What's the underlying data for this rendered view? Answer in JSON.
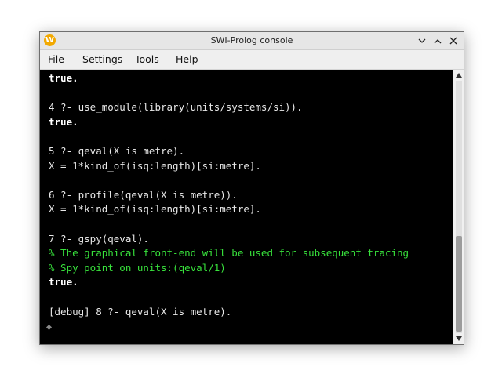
{
  "window": {
    "title": "SWI-Prolog console",
    "app_icon_letter": "W"
  },
  "menu": {
    "file": {
      "underline": "F",
      "rest": "ile"
    },
    "settings": {
      "underline": "S",
      "rest": "ettings"
    },
    "tools": {
      "underline": "T",
      "rest": "ools"
    },
    "help": {
      "underline": "H",
      "rest": "elp"
    }
  },
  "console": {
    "lines": [
      {
        "text": "true.",
        "style": "bold"
      },
      {
        "text": "",
        "style": "normal"
      },
      {
        "text": "4 ?- use_module(library(units/systems/si)).",
        "style": "normal"
      },
      {
        "text": "true.",
        "style": "bold"
      },
      {
        "text": "",
        "style": "normal"
      },
      {
        "text": "5 ?- qeval(X is metre).",
        "style": "normal"
      },
      {
        "text": "X = 1*kind_of(isq:length)[si:metre].",
        "style": "normal"
      },
      {
        "text": "",
        "style": "normal"
      },
      {
        "text": "6 ?- profile(qeval(X is metre)).",
        "style": "normal"
      },
      {
        "text": "X = 1*kind_of(isq:length)[si:metre].",
        "style": "normal"
      },
      {
        "text": "",
        "style": "normal"
      },
      {
        "text": "7 ?- gspy(qeval).",
        "style": "normal"
      },
      {
        "text": "% The graphical front-end will be used for subsequent tracing",
        "style": "green"
      },
      {
        "text": "% Spy point on units:(qeval/1)",
        "style": "green"
      },
      {
        "text": "true.",
        "style": "bold"
      },
      {
        "text": "",
        "style": "normal"
      },
      {
        "text": "[debug] 8 ?- qeval(X is metre).",
        "style": "normal"
      }
    ]
  },
  "colors": {
    "console_background": "#000000",
    "console_text": "#e8e8e8",
    "message_text": "#38e23c",
    "titlebar": "#e6e6e6",
    "menubar": "#efefef"
  },
  "icons": {
    "minimize": "chevron-down-icon",
    "maximize": "chevron-up-icon",
    "close": "close-icon",
    "scroll_up": "triangle-up-icon",
    "scroll_down": "triangle-down-icon"
  }
}
